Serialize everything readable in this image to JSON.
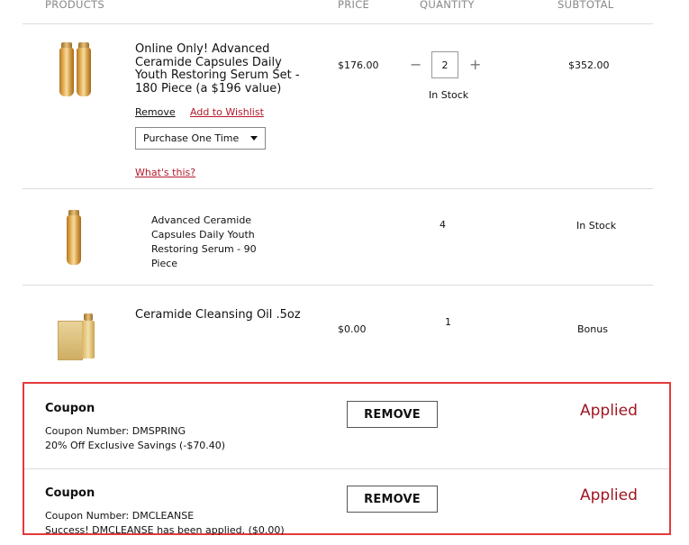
{
  "header": {
    "products": "PRODUCTS",
    "price": "PRICE",
    "quantity": "QUANTITY",
    "subtotal": "SUBTOTAL"
  },
  "items": [
    {
      "name": "Online Only! Advanced Ceramide Capsules Daily Youth Restoring Serum Set - 180 Piece (a $196 value)",
      "price": "$176.00",
      "quantity": "2",
      "stock": "In Stock",
      "subtotal": "$352.00",
      "remove_label": "Remove",
      "wishlist_label": "Add to Wishlist",
      "purchase_option": "Purchase One Time",
      "whats_this": "What's this?",
      "minus": "−",
      "plus": "+"
    },
    {
      "name": "Advanced Ceramide Capsules Daily Youth Restoring Serum - 90 Piece",
      "quantity": "4",
      "subtotal": "In Stock"
    },
    {
      "name": "Ceramide Cleansing Oil .5oz",
      "price": "$0.00",
      "quantity": "1",
      "subtotal": "Bonus"
    }
  ],
  "coupons": [
    {
      "title": "Coupon",
      "number": "Coupon Number: DMSPRING",
      "detail": "20% Off Exclusive Savings (-$70.40)",
      "button": "REMOVE",
      "status": "Applied"
    },
    {
      "title": "Coupon",
      "number": "Coupon Number: DMCLEANSE",
      "detail": "Success! DMCLEANSE has been applied. ($0.00)",
      "button": "REMOVE",
      "status": "Applied"
    }
  ],
  "colors": {
    "accent_red": "#a01522",
    "highlight_border": "#e33a3a",
    "link_red": "#b4182b"
  }
}
